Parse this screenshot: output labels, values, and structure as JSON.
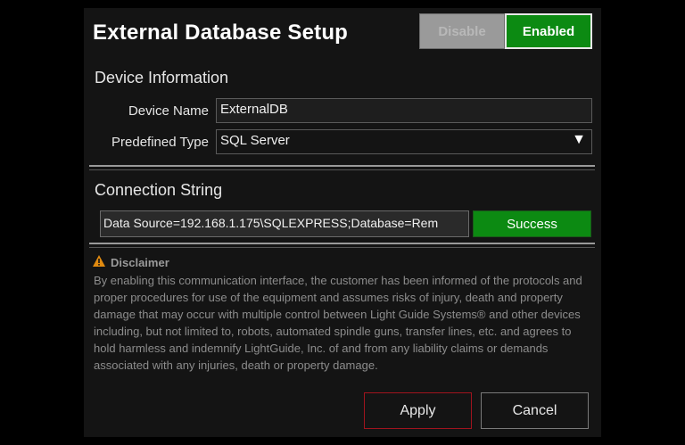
{
  "dialog": {
    "title": "External Database Setup",
    "toggle": {
      "disable_label": "Disable",
      "enabled_label": "Enabled",
      "state": "Enabled"
    },
    "device_info": {
      "heading": "Device Information",
      "device_name_label": "Device Name",
      "device_name_value": "ExternalDB",
      "predefined_type_label": "Predefined Type",
      "predefined_type_value": "SQL Server",
      "dropdown_arrow": "▼"
    },
    "connection": {
      "heading": "Connection String",
      "value": "Data Source=192.168.1.175\\SQLEXPRESS;Database=Rem",
      "status_label": "Success"
    },
    "disclaimer": {
      "icon": "warning-icon",
      "title": "Disclaimer",
      "text": "By enabling this communication interface, the customer has been informed of the protocols and proper procedures for use of the equipment and assumes risks of injury, death and property damage that may occur with multiple control between Light Guide Systems® and other devices including, but not limited to, robots, automated spindle guns, transfer lines, etc. and agrees to hold harmless and indemnify LightGuide, Inc. of and from any liability claims or demands associated with any injuries, death or property damage."
    },
    "buttons": {
      "apply_label": "Apply",
      "cancel_label": "Cancel"
    },
    "colors": {
      "success_green": "#0c8a12",
      "apply_border": "#a0141e",
      "warning_orange": "#e08a10"
    }
  }
}
